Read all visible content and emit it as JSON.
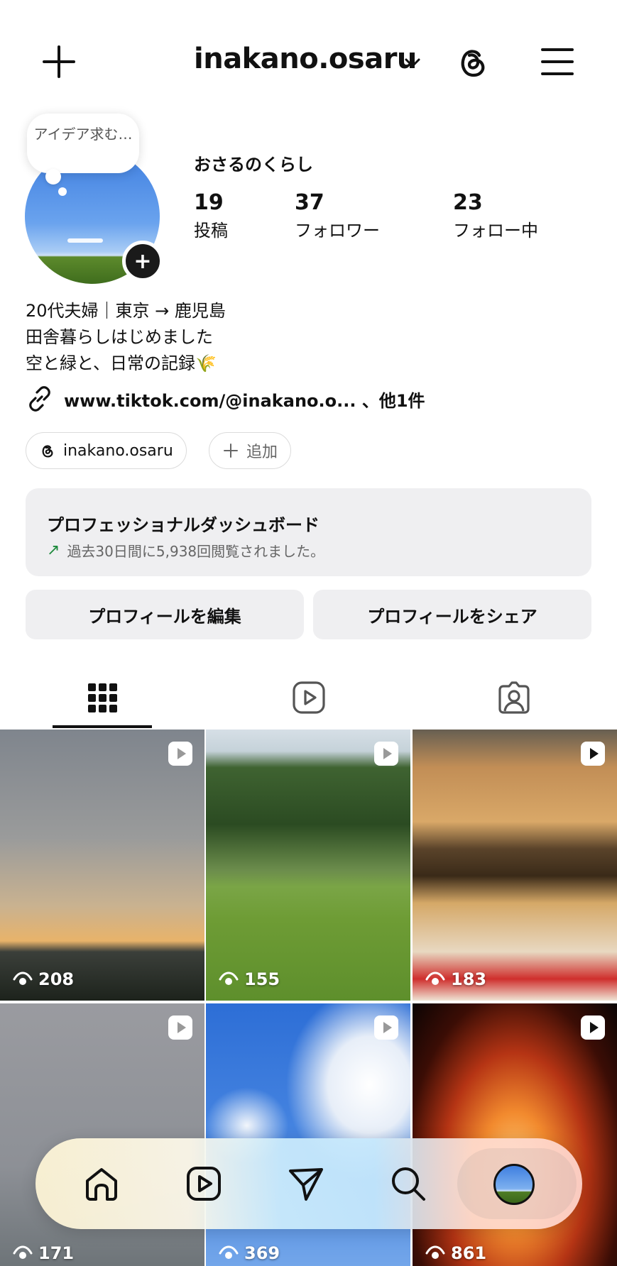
{
  "header": {
    "username": "inakano.osaru",
    "icons": [
      "plus-icon",
      "chevron-down-icon",
      "threads-icon",
      "menu-icon"
    ]
  },
  "profile": {
    "note_bubble": "アイデア求む…",
    "display_name": "おさるのくらし",
    "stats": [
      {
        "num": "19",
        "label": "投稿"
      },
      {
        "num": "37",
        "label": "フォロワー"
      },
      {
        "num": "23",
        "label": "フォロー中"
      }
    ],
    "bio": [
      "20代夫婦｜東京 → 鹿児島",
      "田舎暮らしはじめました",
      "空と緑と、日常の記録🌾"
    ],
    "link": "www.tiktok.com/@inakano.o... 、他1件",
    "chips": {
      "threads": "inakano.osaru",
      "add": "追加"
    }
  },
  "dashboard": {
    "title": "プロフェッショナルダッシュボード",
    "subtitle": "過去30日間に5,938回閲覧されました。",
    "accent": "#1d8a3c"
  },
  "actions": {
    "edit": "プロフィールを編集",
    "share": "プロフィールをシェア"
  },
  "tabs": [
    "grid-icon",
    "reels-icon",
    "tagged-icon"
  ],
  "posts": [
    {
      "views": "208",
      "type": "reel"
    },
    {
      "views": "155",
      "type": "reel"
    },
    {
      "views": "183",
      "type": "reel"
    },
    {
      "views": "171",
      "type": "reel"
    },
    {
      "views": "369",
      "type": "reel"
    },
    {
      "views": "861",
      "type": "reel"
    }
  ],
  "nav": [
    "home-icon",
    "reels-icon",
    "direct-message-icon",
    "search-icon",
    "profile-avatar"
  ]
}
